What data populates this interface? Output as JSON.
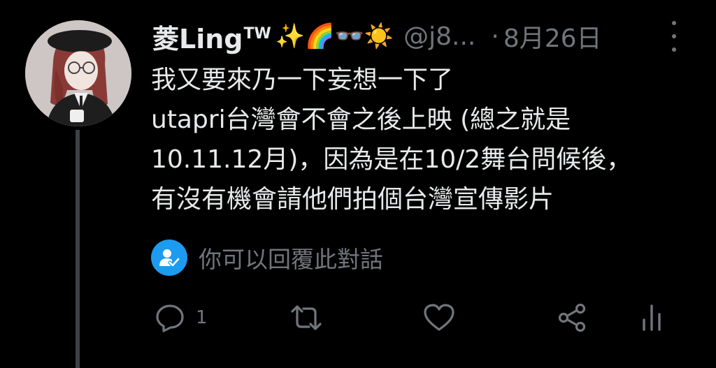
{
  "tweet": {
    "display_name": "菱Ling",
    "name_superscript": "TW",
    "name_emoji": "✨🌈👓☀️",
    "handle": "@j8...",
    "separator": "·",
    "timestamp": "8月26日",
    "text_lines": [
      "我又要來乃一下妄想一下了",
      "utapri台灣會不會之後上映 (總之就是",
      "10.11.12月)，因為是在10/2舞台問候後，",
      "有沒有機會請他們拍個台灣宣傳影片"
    ],
    "reply_restriction": "你可以回覆此對話"
  },
  "actions": {
    "reply_count": "1"
  },
  "colors": {
    "background": "#000000",
    "primary_text": "#e7e9ea",
    "secondary_text": "#71767b",
    "accent": "#1d9bf0",
    "thread_line": "#3e4144"
  },
  "icons": {
    "reply": "reply-icon",
    "retweet": "retweet-icon",
    "like": "like-icon",
    "share": "share-icon",
    "views": "views-icon",
    "more": "more-icon",
    "restrict": "user-check-icon"
  }
}
